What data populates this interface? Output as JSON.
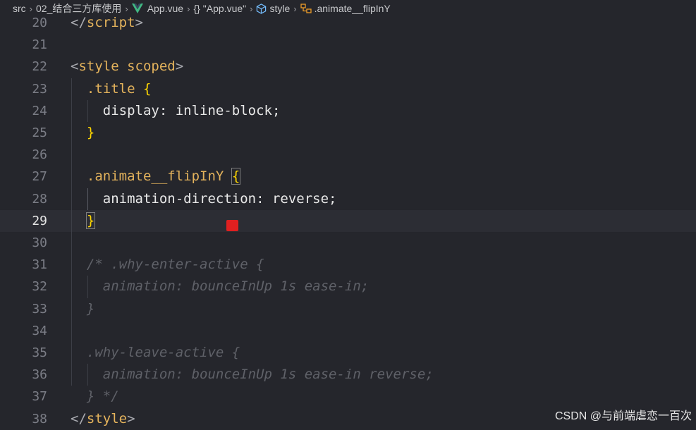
{
  "breadcrumb": {
    "items": [
      "src",
      "02_结合三方库使用",
      "App.vue",
      "\"App.vue\"",
      "style",
      ".animate__flipInY"
    ],
    "braces_glyph": "{}",
    "icons": [
      "chevron-right-icon",
      "vue-icon",
      "braces-icon",
      "cube-icon",
      "symbol-class-icon"
    ]
  },
  "editor": {
    "active_line": 29,
    "lines": [
      {
        "num": "20",
        "tokens": [
          [
            "tag",
            "</"
          ],
          [
            "tagname",
            "script"
          ],
          [
            "tag",
            ">"
          ]
        ]
      },
      {
        "num": "21",
        "tokens": []
      },
      {
        "num": "22",
        "tokens": [
          [
            "tag",
            "<"
          ],
          [
            "tagname",
            "style"
          ],
          [
            "prop",
            " "
          ],
          [
            "attr",
            "scoped"
          ],
          [
            "tag",
            ">"
          ]
        ]
      },
      {
        "num": "23",
        "tokens": [
          [
            "prop",
            "  "
          ],
          [
            "sel",
            ".title"
          ],
          [
            "prop",
            " "
          ],
          [
            "brace",
            "{"
          ]
        ]
      },
      {
        "num": "24",
        "tokens": [
          [
            "prop",
            "    display: inline-block;"
          ]
        ]
      },
      {
        "num": "25",
        "tokens": [
          [
            "prop",
            "  "
          ],
          [
            "brace",
            "}"
          ]
        ]
      },
      {
        "num": "26",
        "tokens": []
      },
      {
        "num": "27",
        "tokens": [
          [
            "prop",
            "  "
          ],
          [
            "sel",
            ".animate__flipInY"
          ],
          [
            "prop",
            " "
          ],
          [
            "brace-box",
            "{"
          ]
        ]
      },
      {
        "num": "28",
        "tokens": [
          [
            "prop",
            "    animation-direction: reverse;"
          ]
        ]
      },
      {
        "num": "29",
        "tokens": [
          [
            "prop",
            "  "
          ],
          [
            "brace-box",
            "}"
          ]
        ]
      },
      {
        "num": "30",
        "tokens": []
      },
      {
        "num": "31",
        "tokens": [
          [
            "comment",
            "  /* .why-enter-active {"
          ]
        ]
      },
      {
        "num": "32",
        "tokens": [
          [
            "comment",
            "    animation: bounceInUp 1s ease-in;"
          ]
        ]
      },
      {
        "num": "33",
        "tokens": [
          [
            "comment",
            "  }"
          ]
        ]
      },
      {
        "num": "34",
        "tokens": []
      },
      {
        "num": "35",
        "tokens": [
          [
            "comment",
            "  .why-leave-active {"
          ]
        ]
      },
      {
        "num": "36",
        "tokens": [
          [
            "comment",
            "    animation: bounceInUp 1s ease-in reverse;"
          ]
        ]
      },
      {
        "num": "37",
        "tokens": [
          [
            "comment",
            "  } */"
          ]
        ]
      },
      {
        "num": "38",
        "tokens": [
          [
            "tag",
            "</"
          ],
          [
            "tagname",
            "style"
          ],
          [
            "tag",
            ">"
          ]
        ]
      }
    ]
  },
  "colors": {
    "background": "#25262c",
    "keyword": "#e4b35c",
    "bracket": "#ffd700",
    "comment": "#5f6168",
    "marker": "#e02020"
  },
  "watermark": "CSDN @与前端虐恋一百次"
}
